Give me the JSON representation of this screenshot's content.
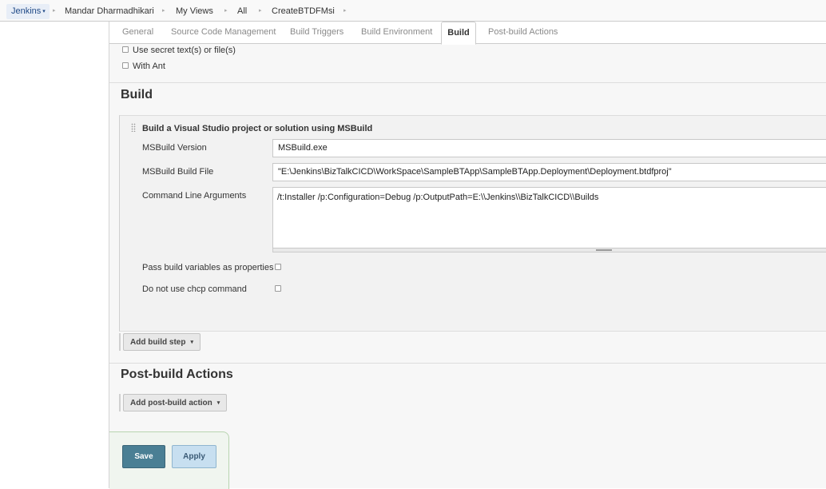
{
  "breadcrumb": {
    "items": [
      "Jenkins",
      "Mandar Dharmadhikari",
      "My Views",
      "All",
      "CreateBTDFMsi"
    ],
    "separator": "▸",
    "jenkins_caret": "▾"
  },
  "tabs": [
    {
      "label": "General"
    },
    {
      "label": "Source Code Management"
    },
    {
      "label": "Build Triggers"
    },
    {
      "label": "Build Environment"
    },
    {
      "label": "Build",
      "active": true
    },
    {
      "label": "Post-build Actions"
    }
  ],
  "build_environment": {
    "options": [
      {
        "label": "Use secret text(s) or file(s)",
        "checked": false
      },
      {
        "label": "With Ant",
        "checked": false
      }
    ]
  },
  "build": {
    "title": "Build",
    "step": {
      "title": "Build a Visual Studio project or solution using MSBuild",
      "msbuild_version_label": "MSBuild Version",
      "msbuild_version_value": "MSBuild.exe",
      "build_file_label": "MSBuild Build File",
      "build_file_value": "\"E:\\Jenkins\\BizTalkCICD\\WorkSpace\\SampleBTApp\\SampleBTApp.Deployment\\Deployment.btdfproj\"",
      "cmd_args_label": "Command Line Arguments",
      "cmd_args_value": "/t:Installer /p:Configuration=Debug /p:OutputPath=E:\\\\Jenkins\\\\BizTalkCICD\\\\Builds",
      "pass_vars_label": "Pass build variables as properties",
      "pass_vars_checked": false,
      "no_chcp_label": "Do not use chcp command",
      "no_chcp_checked": false
    },
    "add_step_label": "Add build step",
    "dropdown_caret": "▾"
  },
  "post_build": {
    "title": "Post-build Actions",
    "add_action_label": "Add post-build action"
  },
  "buttons": {
    "save_label": "Save",
    "apply_label": "Apply"
  },
  "colors": {
    "save_button": "#4a7f94",
    "apply_button": "#c7dff0",
    "breadcrumb_link": "#204a87"
  }
}
